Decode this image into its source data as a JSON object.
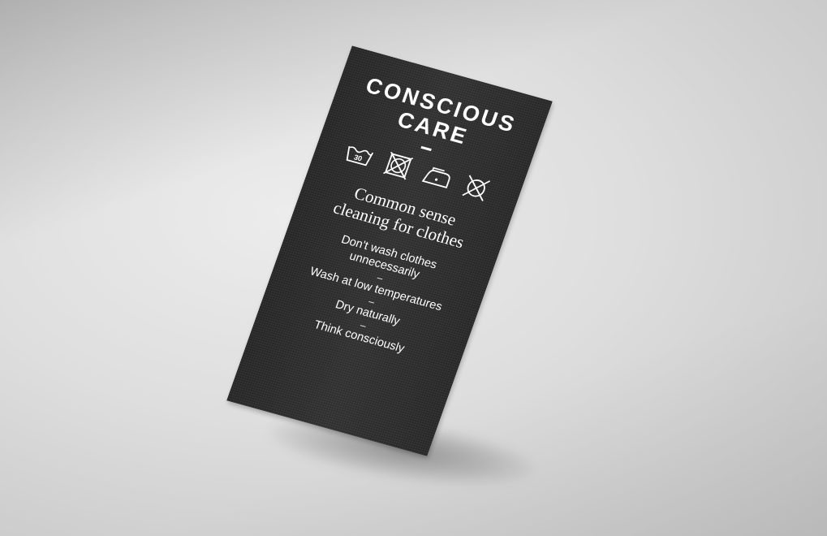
{
  "label": {
    "title_lines": [
      "CONSCIOUS",
      "CARE"
    ],
    "care_symbols": {
      "wash_temperature": "30",
      "icons": [
        "wash-30-icon",
        "no-tumble-dry-icon",
        "low-iron-icon",
        "no-dry-clean-icon"
      ]
    },
    "subtitle_lines": [
      "Common sense",
      "cleaning for clothes"
    ],
    "separator": "–",
    "tips": [
      {
        "lines": [
          "Don't wash clothes",
          "unnecessarily"
        ]
      },
      {
        "lines": [
          "Wash at low temperatures"
        ]
      },
      {
        "lines": [
          "Dry naturally"
        ]
      },
      {
        "lines": [
          "Think consciously"
        ]
      }
    ]
  },
  "colors": {
    "label_fabric": "#2f2f2f",
    "text": "#ffffff",
    "background": "#dedede"
  }
}
